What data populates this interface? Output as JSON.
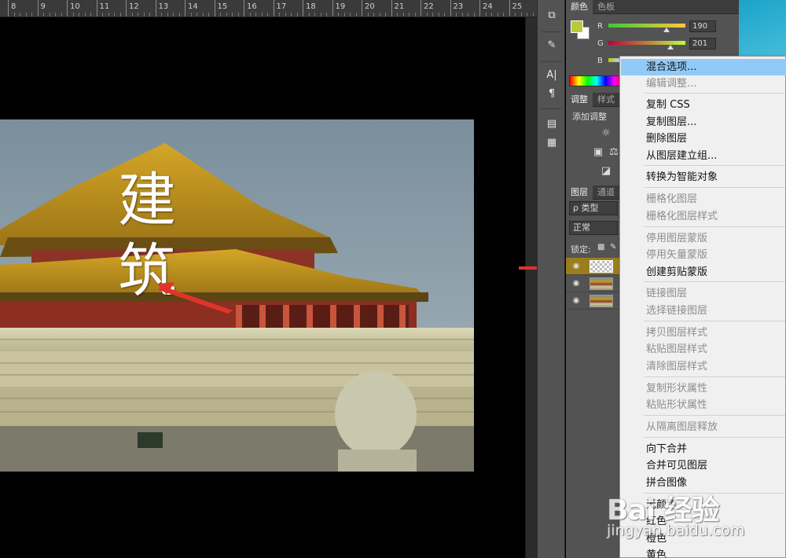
{
  "ruler": {
    "labels": [
      "8",
      "9",
      "10",
      "11",
      "12",
      "13",
      "14",
      "15",
      "16",
      "17",
      "18",
      "19",
      "20",
      "21",
      "22",
      "23",
      "24",
      "25"
    ]
  },
  "canvas": {
    "overlay_text": [
      "建",
      "筑"
    ]
  },
  "color_panel": {
    "tabs": [
      "颜色",
      "色板"
    ],
    "channels": [
      {
        "label": "R",
        "value": "190"
      },
      {
        "label": "G",
        "value": "201"
      },
      {
        "label": "B",
        "value": ""
      }
    ],
    "foreground_color": "#b9c93a"
  },
  "adjust_panel": {
    "tabs": [
      "调整",
      "样式"
    ],
    "add_label": "添加调整"
  },
  "layers_panel": {
    "tabs": [
      "图层",
      "通道"
    ],
    "filter_label": "ρ 类型",
    "blend_mode": "正常",
    "lock_label": "锁定:",
    "selected_color": "#9a7d1e"
  },
  "context_menu": {
    "items": [
      {
        "label": "混合选项...",
        "disabled": false,
        "highlight": true
      },
      {
        "label": "编辑调整...",
        "disabled": true
      },
      {
        "label": "复制 CSS",
        "disabled": false
      },
      {
        "label": "复制图层...",
        "disabled": false
      },
      {
        "label": "删除图层",
        "disabled": false
      },
      {
        "label": "从图层建立组...",
        "disabled": false
      },
      {
        "label": "转换为智能对象",
        "disabled": false
      },
      {
        "label": "栅格化图层",
        "disabled": true
      },
      {
        "label": "栅格化图层样式",
        "disabled": true
      },
      {
        "label": "停用图层蒙版",
        "disabled": true
      },
      {
        "label": "停用矢量蒙版",
        "disabled": true
      },
      {
        "label": "创建剪贴蒙版",
        "disabled": false
      },
      {
        "label": "链接图层",
        "disabled": true
      },
      {
        "label": "选择链接图层",
        "disabled": true
      },
      {
        "label": "拷贝图层样式",
        "disabled": true
      },
      {
        "label": "粘贴图层样式",
        "disabled": true
      },
      {
        "label": "清除图层样式",
        "disabled": true
      },
      {
        "label": "复制形状属性",
        "disabled": true
      },
      {
        "label": "粘贴形状属性",
        "disabled": true
      },
      {
        "label": "从隔离图层释放",
        "disabled": true
      },
      {
        "label": "向下合并",
        "disabled": false
      },
      {
        "label": "合并可见图层",
        "disabled": false
      },
      {
        "label": "拼合图像",
        "disabled": false
      },
      {
        "label": "无颜色",
        "disabled": false
      },
      {
        "label": "红色",
        "disabled": false
      },
      {
        "label": "橙色",
        "disabled": false
      },
      {
        "label": "黄色",
        "disabled": false
      }
    ],
    "highlight_color": "#91c9f7"
  },
  "watermark": {
    "brand": "Bai 经验",
    "url": "jingyan.baidu.com"
  }
}
